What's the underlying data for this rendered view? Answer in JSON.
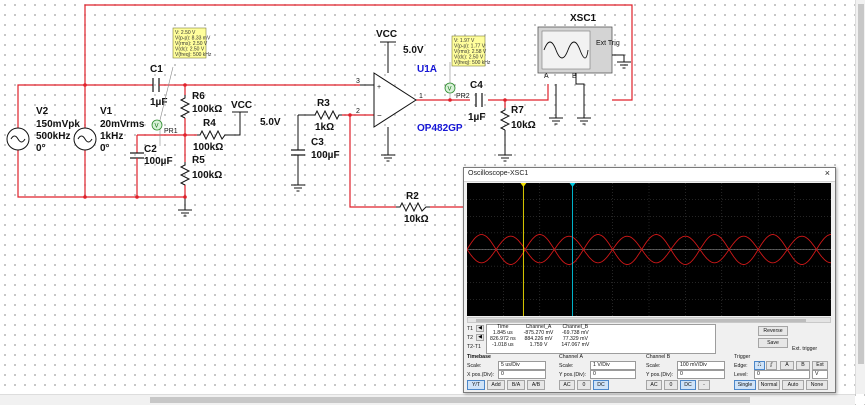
{
  "labels": {
    "v2_name": "V2",
    "v2_amp": "150mVpk",
    "v2_freq": "500kHz",
    "v2_phase": "0°",
    "v1_name": "V1",
    "v1_amp": "20mVrms",
    "v1_freq": "1kHz",
    "v1_phase": "0°",
    "c1_name": "C1",
    "c1_val": "1µF",
    "c2_name": "C2",
    "c2_val": "100µF",
    "c3_name": "C3",
    "c3_val": "100µF",
    "c4_name": "C4",
    "c4_val": "1µF",
    "r6_name": "R6",
    "r6_val": "100kΩ",
    "r4_name": "R4",
    "r4_val": "100kΩ",
    "r5_name": "R5",
    "r5_val": "100kΩ",
    "r3_name": "R3",
    "r3_val": "1kΩ",
    "r2_name": "R2",
    "r2_val": "10kΩ",
    "r7_name": "R7",
    "r7_val": "10kΩ",
    "vcc1": "VCC",
    "vcc1_val": "5.0V",
    "vcc2": "VCC",
    "vcc2_val": "5.0V",
    "u1a": "U1A",
    "op_model": "OP482GP",
    "xsc1": "XSC1",
    "ext_trig": "Ext Trig",
    "pr1": "PR1",
    "pr2": "PR2",
    "ch_a": "A",
    "ch_b": "B",
    "pin2": "2",
    "pin3": "3",
    "pin1": "1",
    "probe_v": "V"
  },
  "probe1": {
    "v": "V: 2.50 V",
    "vpp": "V(p-p): 8.33 mV",
    "vrms": "V(rms): 2.50 V",
    "vdc": "V(dc): 2.50 V",
    "vfreq": "V(freq): 500 kHz"
  },
  "probe2": {
    "v": "V: 1.97 V",
    "vpp": "V(p-p): 1.77 V",
    "vrms": "V(rms): 2.58 V",
    "vdc": "V(dc): 2.50 V",
    "vfreq": "V(freq): 500 kHz"
  },
  "scope": {
    "title": "Oscilloscope-XSC1",
    "close": "×",
    "t1": "T1",
    "t2": "T2",
    "t2t1": "T2-T1",
    "col_time": "Time",
    "col_a": "Channel_A",
    "col_b": "Channel_B",
    "r1_time": "1.845 us",
    "r1_a": "-875.270 mV",
    "r1_b": "-69.738 mV",
    "r2_time": "826.972 ns",
    "r2_a": "884.226 mV",
    "r2_b": "77.329 mV",
    "r3_time": "-1.018 us",
    "r3_a": "1.759 V",
    "r3_b": "147.067 mV",
    "reverse": "Reverse",
    "save": "Save",
    "ext_trigger": "Ext. trigger",
    "timebase": "Timebase",
    "scale": "Scale:",
    "tb_scale": "5 us/Div",
    "xpos": "X pos.(Div):",
    "xpos_val": "0",
    "yt": "Y/T",
    "add": "Add",
    "ba": "B/A",
    "ab": "A/B",
    "channel_a": "Channel A",
    "cha_scale": "1 V/Div",
    "ypos": "Y pos.(Div):",
    "cha_ypos": "0",
    "ac": "AC",
    "zero": "0",
    "dc": "DC",
    "channel_b": "Channel B",
    "chb_scale": "100 mV/Div",
    "chb_ypos": "0",
    "minus": "-",
    "trigger": "Trigger",
    "edge": "Edge:",
    "level": "Level:",
    "level_val": "0",
    "level_unit": "V",
    "trig_a": "A",
    "trig_b": "B",
    "trig_ext": "Ext",
    "single": "Single",
    "normal": "Normal",
    "auto": "Auto",
    "none": "None"
  },
  "colors": {
    "wire": "#e0202a",
    "channel_a_trace": "#d01818",
    "channel_b_trace": "#d01818",
    "cursor1": "#f2e000",
    "cursor2": "#00c8e0",
    "op_label": "#1515d6"
  },
  "chart_data": {
    "type": "line",
    "title": "",
    "xlabel": "",
    "ylabel": "",
    "divisions_x": 10,
    "divisions_y": 8,
    "x_per_div_us": 5,
    "series": [
      {
        "name": "Channel_A",
        "volts_per_div": 1,
        "amplitude_div": 0.9,
        "period_div": 0.4,
        "phase": 0
      },
      {
        "name": "Channel_B",
        "volts_per_div": 0.1,
        "amplitude_div": 0.8,
        "period_div": 0.4,
        "phase": 3.14159
      }
    ],
    "cursors_div": [
      1.55,
      2.9
    ],
    "grid": true
  }
}
